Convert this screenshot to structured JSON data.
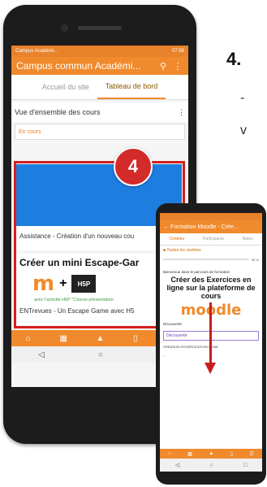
{
  "step_number": "4.",
  "side_letters": [
    "-",
    "v"
  ],
  "main_phone": {
    "status_left": "Campus Académi...",
    "status_right": "07:58",
    "app_title": "Campus commun Académi...",
    "tabs": [
      {
        "label": "Accueil du site",
        "active": false
      },
      {
        "label": "Tableau de bord",
        "active": true
      }
    ],
    "overview_label": "Vue d'ensemble des cours",
    "filter_label": "En cours",
    "badge": "4",
    "card1_title": "Assistance - Création d'un nouveau cou",
    "card2_heading": "Créer un mini Escape-Gar",
    "card2_subtitle": "avec l'activité H5P \"Course présentation",
    "card2_title": "ENTrevues - Un Escape Game avec H5",
    "h5p_text": "H5P"
  },
  "second_phone": {
    "title": "Formation Moodle - Crée...",
    "tabs": [
      {
        "label": "Contenu",
        "active": true
      },
      {
        "label": "Participants",
        "active": false
      },
      {
        "label": "Notes",
        "active": false
      }
    ],
    "section_label": "Toutes les sections",
    "progress": "96 %",
    "intro": "Bienvenue dans le parcours de formation",
    "heading": "Créer des Exercices en ligne sur la plateforme de cours",
    "logo": "moodle",
    "footer_label": "Découverte",
    "discovery_label": "Découverte",
    "item1": "CREATION D'EXERCICES EN LIGNE",
    "item2": "..."
  },
  "colors": {
    "accent": "#f08a2c",
    "highlight": "#d32020",
    "card_blue": "#1e7ee0"
  }
}
